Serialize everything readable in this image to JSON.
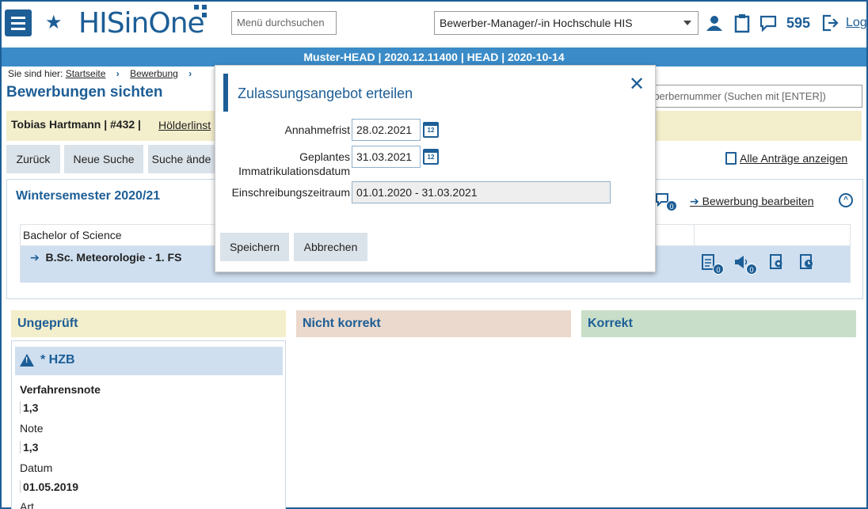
{
  "header": {
    "logo": "HISinOne",
    "search_label": "Menü durchsuchen",
    "role": "Bewerber-Manager/-in Hochschule HIS",
    "count": "595",
    "logout": "Log"
  },
  "system_bar": "Muster-HEAD | 2020.12.11400 | HEAD | 2020-10-14",
  "breadcrumb": {
    "prefix": "Sie sind hier:",
    "items": [
      "Startseite",
      "Bewerbung"
    ]
  },
  "page_title": "Bewerbungen sichten",
  "right_search_placeholder": "rberbernummer (Suchen mit [ENTER])",
  "applicant": {
    "name": "Tobias Hartmann | #432 |",
    "school": "Hölderlinst"
  },
  "toolbar": {
    "back": "Zurück",
    "new_search": "Neue Suche",
    "change_search": "Suche ände",
    "all_requests": "Alle Anträge anzeigen"
  },
  "semester": {
    "title": "Wintersemester 2020/21",
    "edit": "Bewerbung bearbeiten",
    "comments": "0",
    "degree": "Bachelor of Science",
    "course": "B.Sc. Meteorologie - 1. FS",
    "doc_count": "0",
    "announce_count": "0"
  },
  "columns": {
    "unchecked": "Ungeprüft",
    "incorrect": "Nicht korrekt",
    "correct": "Korrekt"
  },
  "card": {
    "title": "* HZB",
    "fields": [
      {
        "label": "Verfahrensnote",
        "value": "1,3"
      },
      {
        "label": "Note",
        "value": "1,3"
      },
      {
        "label": "Datum",
        "value": "01.05.2019"
      },
      {
        "label": "Art",
        "value": ""
      }
    ]
  },
  "modal": {
    "title": "Zulassungsangebot erteilen",
    "close": "✕",
    "acceptance_deadline_label": "Annahmefrist",
    "acceptance_deadline": "28.02.2021",
    "planned_label_1": "Geplantes",
    "planned_label_2": "Immatrikulationsdatum",
    "planned_date": "31.03.2021",
    "period_label": "Einschreibungszeitraum",
    "period": "01.01.2020 - 31.03.2021",
    "calendar_day": "12",
    "save": "Speichern",
    "cancel": "Abbrechen"
  },
  "colors": {
    "brand": "#1d5e96",
    "sysbar": "#3a8bc7"
  }
}
